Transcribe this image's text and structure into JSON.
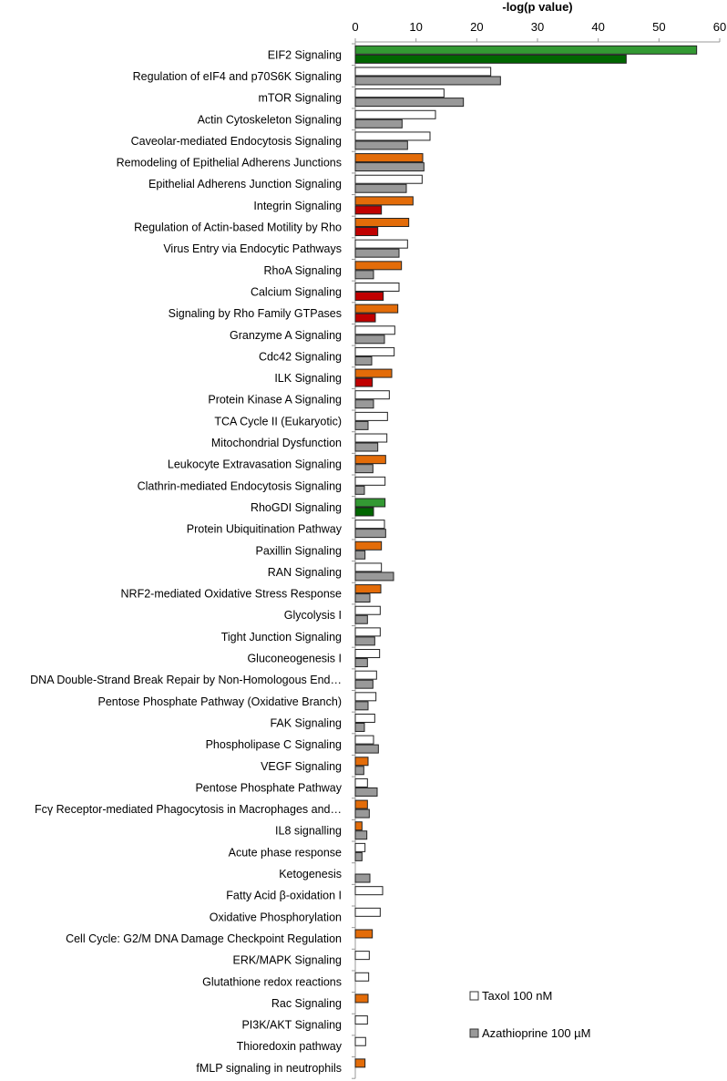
{
  "chart_data": {
    "type": "bar",
    "orientation": "horizontal",
    "title": "",
    "xlabel": "-log(p value)",
    "ylabel": "",
    "xlim": [
      0,
      60
    ],
    "xticks": [
      0,
      10,
      20,
      30,
      40,
      50,
      60
    ],
    "axis_position": "top",
    "legend_position": "bottom-right",
    "grid": false,
    "colors": {
      "taxol_default": "#ffffff",
      "aza_default": "#999999",
      "orange": "#e36c09",
      "red": "#c00000",
      "green_light": "#339933",
      "green_dark": "#006600",
      "outline": "#222222"
    },
    "series": [
      {
        "name": "Taxol 100 nM",
        "legend_color": "#ffffff"
      },
      {
        "name": "Azathioprine 100 µM",
        "legend_color": "#999999"
      }
    ],
    "categories": [
      "EIF2 Signaling",
      "Regulation of eIF4 and p70S6K Signaling",
      "mTOR Signaling",
      "Actin Cytoskeleton Signaling",
      "Caveolar-mediated Endocytosis Signaling",
      "Remodeling of Epithelial Adherens Junctions",
      "Epithelial Adherens Junction Signaling",
      "Integrin Signaling",
      "Regulation of Actin-based Motility by Rho",
      "Virus Entry via Endocytic Pathways",
      "RhoA Signaling",
      "Calcium Signaling",
      "Signaling by Rho Family GTPases",
      "Granzyme A Signaling",
      "Cdc42 Signaling",
      "ILK Signaling",
      "Protein Kinase A Signaling",
      "TCA Cycle II (Eukaryotic)",
      "Mitochondrial Dysfunction",
      "Leukocyte Extravasation Signaling",
      "Clathrin-mediated Endocytosis Signaling",
      "RhoGDI Signaling",
      "Protein Ubiquitination Pathway",
      "Paxillin Signaling",
      "RAN Signaling",
      "NRF2-mediated Oxidative Stress Response",
      "Glycolysis I",
      "Tight Junction Signaling",
      "Gluconeogenesis I",
      "DNA Double-Strand Break Repair by Non-Homologous End…",
      "Pentose Phosphate Pathway (Oxidative Branch)",
      "FAK Signaling",
      "Phospholipase C Signaling",
      "VEGF Signaling",
      "Pentose Phosphate Pathway",
      "Fcγ Receptor-mediated Phagocytosis in Macrophages and…",
      "IL8 signalling",
      "Acute phase response",
      "Ketogenesis",
      "Fatty Acid β-oxidation I",
      "Oxidative Phosphorylation",
      "Cell Cycle: G2/M DNA Damage Checkpoint Regulation",
      "ERK/MAPK Signaling",
      "Glutathione redox reactions",
      "Rac Signaling",
      "PI3K/AKT Signaling",
      "Thioredoxin pathway",
      "fMLP signaling in neutrophils"
    ],
    "taxol": [
      56.2,
      22.3,
      14.6,
      13.2,
      12.3,
      11.1,
      11.0,
      9.5,
      8.8,
      8.6,
      7.6,
      7.2,
      7.0,
      6.5,
      6.4,
      6.0,
      5.6,
      5.3,
      5.2,
      5.0,
      4.9,
      4.9,
      4.8,
      4.3,
      4.3,
      4.2,
      4.1,
      4.1,
      4.0,
      3.5,
      3.4,
      3.2,
      3.0,
      2.1,
      2.0,
      2.0,
      1.1,
      1.6,
      null,
      4.5,
      4.1,
      2.8,
      2.3,
      2.2,
      2.1,
      2.0,
      1.7,
      1.6
    ],
    "azathioprine": [
      44.6,
      23.9,
      17.8,
      7.7,
      8.6,
      11.3,
      8.4,
      4.3,
      3.7,
      7.2,
      3.0,
      4.6,
      3.3,
      4.8,
      2.7,
      2.8,
      3.0,
      2.1,
      3.7,
      2.9,
      1.5,
      3.0,
      5.0,
      1.6,
      6.3,
      2.4,
      2.0,
      3.2,
      2.0,
      2.9,
      2.1,
      1.5,
      3.8,
      1.4,
      3.6,
      2.3,
      1.9,
      1.1,
      2.4,
      null,
      null,
      null,
      null,
      null,
      null,
      null,
      null,
      null
    ],
    "taxol_color_key": [
      "green_light",
      "w",
      "w",
      "w",
      "w",
      "orange",
      "w",
      "orange",
      "orange",
      "w",
      "orange",
      "w",
      "orange",
      "w",
      "w",
      "orange",
      "w",
      "w",
      "w",
      "orange",
      "w",
      "green_light",
      "w",
      "orange",
      "w",
      "orange",
      "w",
      "w",
      "w",
      "w",
      "w",
      "w",
      "w",
      "orange",
      "w",
      "orange",
      "orange",
      "w",
      "w",
      "w",
      "w",
      "orange",
      "w",
      "w",
      "orange",
      "w",
      "w",
      "orange"
    ],
    "aza_color_key": [
      "green_dark",
      "g",
      "g",
      "g",
      "g",
      "g",
      "g",
      "red",
      "red",
      "g",
      "g",
      "red",
      "red",
      "g",
      "g",
      "red",
      "g",
      "g",
      "g",
      "g",
      "g",
      "green_dark",
      "g",
      "g",
      "g",
      "g",
      "g",
      "g",
      "g",
      "g",
      "g",
      "g",
      "g",
      "g",
      "g",
      "g",
      "g",
      "g",
      "g",
      "g",
      "g",
      "g",
      "g",
      "g",
      "g",
      "g",
      "g",
      "g"
    ]
  }
}
